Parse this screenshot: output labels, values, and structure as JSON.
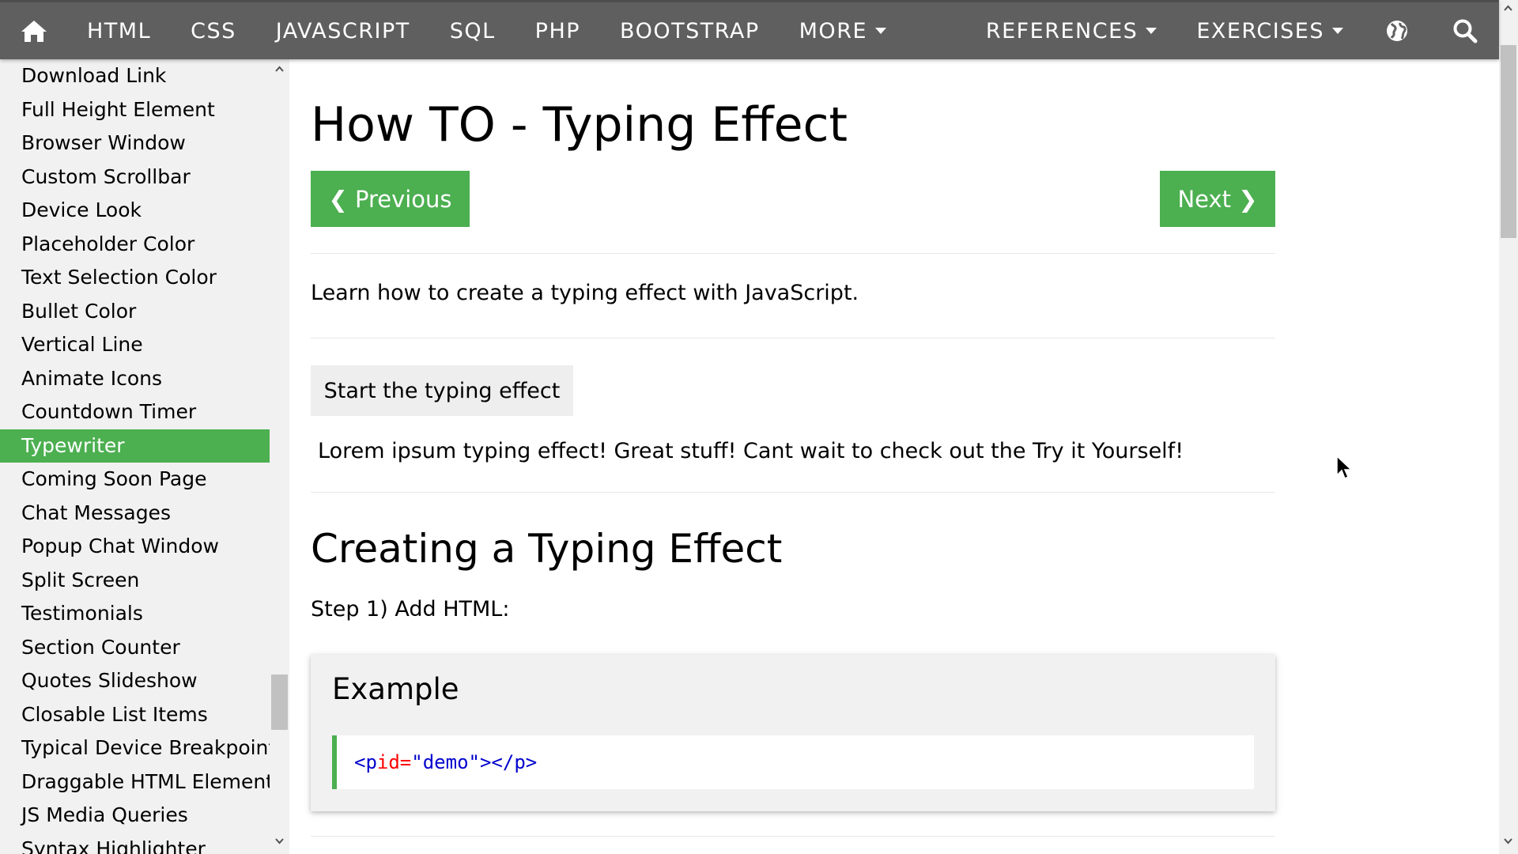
{
  "nav": {
    "items": [
      "HTML",
      "CSS",
      "JAVASCRIPT",
      "SQL",
      "PHP",
      "BOOTSTRAP"
    ],
    "more_label": "MORE",
    "references_label": "REFERENCES",
    "exercises_label": "EXERCISES",
    "icons": {
      "home": "home-icon",
      "globe": "globe-icon",
      "search": "search-icon"
    }
  },
  "sidebar": {
    "items": [
      "Download Link",
      "Full Height Element",
      "Browser Window",
      "Custom Scrollbar",
      "Device Look",
      "Placeholder Color",
      "Text Selection Color",
      "Bullet Color",
      "Vertical Line",
      "Animate Icons",
      "Countdown Timer",
      "Typewriter",
      "Coming Soon Page",
      "Chat Messages",
      "Popup Chat Window",
      "Split Screen",
      "Testimonials",
      "Section Counter",
      "Quotes Slideshow",
      "Closable List Items",
      "Typical Device Breakpoints",
      "Draggable HTML Element",
      "JS Media Queries",
      "Syntax Highlighter"
    ],
    "active_index": 11
  },
  "main": {
    "title": "How TO - Typing Effect",
    "prev_label": "❮ Previous",
    "next_label": "Next ❯",
    "intro": "Learn how to create a typing effect with JavaScript.",
    "start_button": "Start the typing effect",
    "demo_text": "Lorem ipsum typing effect! Great stuff! Cant wait to check out the Try it Yourself!",
    "section_title": "Creating a Typing Effect",
    "step": "Step 1) Add HTML:",
    "example": {
      "title": "Example",
      "code": {
        "open": "<p",
        "attr": " id=",
        "value": "\"demo\"",
        "close": "></p>"
      }
    }
  },
  "colors": {
    "topbar": "#5f5f5f",
    "accent": "#4caf50",
    "sidebar_bg": "#f1f1f1",
    "code_tag": "#0000cd",
    "code_attr": "#ff0000"
  }
}
